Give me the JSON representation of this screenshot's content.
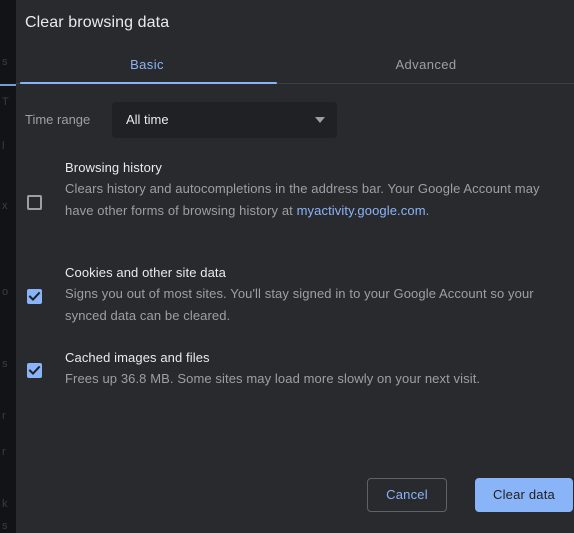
{
  "dialog": {
    "title": "Clear browsing data",
    "tabs": [
      {
        "label": "Basic",
        "active": true
      },
      {
        "label": "Advanced",
        "active": false
      }
    ],
    "time_range": {
      "label": "Time range",
      "selected": "All time"
    },
    "options": [
      {
        "title": "Browsing history",
        "desc_before": "Clears history and autocompletions in the address bar. Your Google Account may have other forms of browsing history at ",
        "link_text": "myactivity.google.com",
        "desc_after": ".",
        "checked": false
      },
      {
        "title": "Cookies and other site data",
        "desc_before": "Signs you out of most sites. You'll stay signed in to your Google Account so your synced data can be cleared.",
        "link_text": "",
        "desc_after": "",
        "checked": true
      },
      {
        "title": "Cached images and files",
        "desc_before": "Frees up 36.8 MB. Some sites may load more slowly on your next visit.",
        "link_text": "",
        "desc_after": "",
        "checked": true
      }
    ],
    "buttons": {
      "cancel": "Cancel",
      "confirm": "Clear data"
    }
  },
  "colors": {
    "dialog_bg": "#292a2d",
    "accent": "#8ab4f8",
    "text_primary": "#e8eaed",
    "text_secondary": "#9aa0a6",
    "select_bg": "#202124",
    "divider": "#3c4043"
  }
}
